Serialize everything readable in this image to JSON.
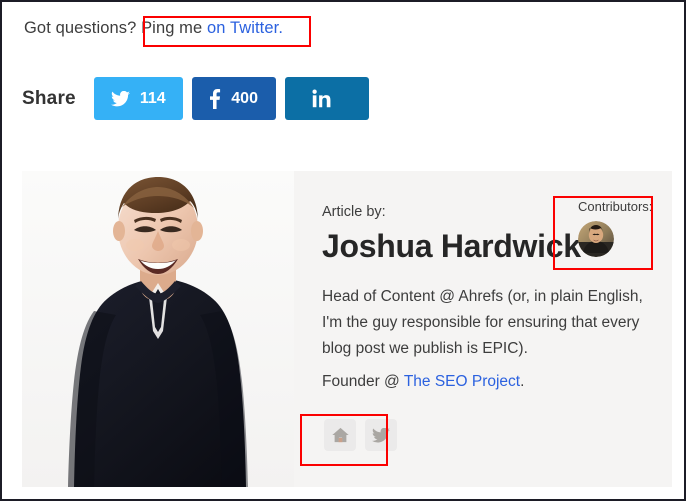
{
  "questions": {
    "prefix": "Got questions? ",
    "highlighted_plain": "Ping me ",
    "link_text": "on Twitter.",
    "link_color": "#2b61df"
  },
  "share": {
    "label": "Share",
    "buttons": [
      {
        "network": "twitter",
        "icon": "twitter-icon",
        "count": "114",
        "color": "#35b1f6"
      },
      {
        "network": "facebook",
        "icon": "facebook-icon",
        "count": "400",
        "color": "#1b5dab"
      },
      {
        "network": "linkedin",
        "icon": "linkedin-icon",
        "count": "",
        "color": "#0c6fa5"
      }
    ]
  },
  "author_card": {
    "photo_alt": "Portrait photo of Joshua Hardwick wearing a dark navy henley shirt",
    "article_by_label": "Article by:",
    "name": "Joshua Hardwick",
    "bio": "Head of Content @ Ahrefs (or, in plain English, I'm the guy responsible for ensuring that every blog post we publish is EPIC).",
    "founder_prefix": "Founder @ ",
    "founder_link": "The SEO Project",
    "founder_suffix": ".",
    "contributors": {
      "label": "Contributors:",
      "avatar_alt": "Contributor avatar photo"
    },
    "social_links": [
      {
        "icon": "home-icon",
        "network": "website"
      },
      {
        "icon": "twitter-icon",
        "network": "twitter"
      }
    ],
    "background_color": "#f5f4f3"
  },
  "annotations": {
    "color": "#fb0000",
    "boxes": [
      {
        "name": "ping-me-on-twitter"
      },
      {
        "name": "contributors"
      },
      {
        "name": "author-social-links"
      }
    ]
  }
}
